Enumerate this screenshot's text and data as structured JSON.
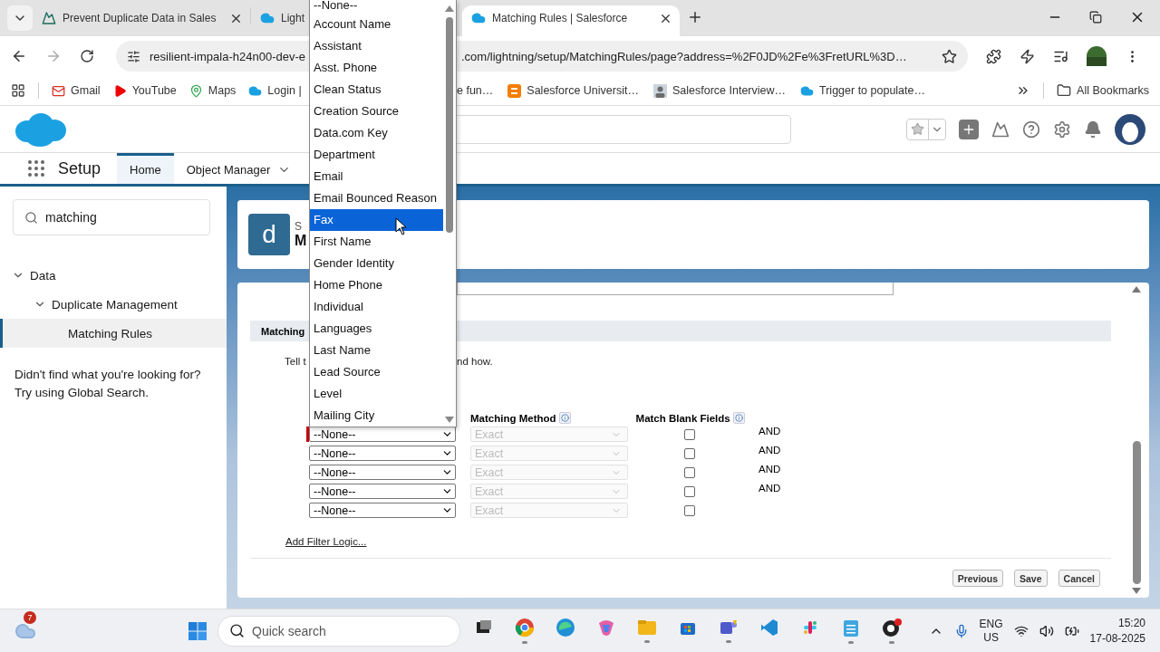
{
  "browser": {
    "tabs": [
      {
        "title": "Prevent Duplicate Data in Sales",
        "selected": false,
        "closable": true
      },
      {
        "title": "Light",
        "selected": false
      },
      {
        "title": "Matching Rules | Salesforce",
        "selected": true,
        "closable": true
      }
    ],
    "url_parts": [
      "resilient-impala-h24n00-dev-e",
      ".com/lightning/setup/MatchingRules/page?address=%2F0JD%2Fe%3FretURL%3D…"
    ],
    "bookmarks_left": [
      "Gmail",
      "YouTube",
      "Maps",
      "Login |"
    ],
    "bookmarks_right": [
      "e fun…",
      "Salesforce Universit…",
      "Salesforce Interview…",
      "Trigger to populate…"
    ],
    "all_bookmarks": "All Bookmarks"
  },
  "salesforce": {
    "nav": {
      "app": "Setup",
      "tabs": [
        {
          "label": "Home",
          "selected": true,
          "menu": false
        },
        {
          "label": "Object Manager",
          "selected": false,
          "menu": true
        }
      ]
    },
    "sidebar": {
      "search": "matching",
      "tree": [
        {
          "label": "Data",
          "expanded": true,
          "selected": false,
          "children": [
            {
              "label": "Duplicate Management",
              "expanded": true,
              "selected": false,
              "children": [
                {
                  "label": "Matching Rules",
                  "selected": true
                }
              ]
            }
          ]
        }
      ],
      "help": "Didn't find what you're looking for? Try using Global Search."
    },
    "page_header": {
      "icon_letter": "d",
      "subtitle": "S",
      "title": "M"
    },
    "form": {
      "section_title": "Matching",
      "description_parts": [
        "Tell t",
        "nd how."
      ],
      "columns": [
        "Matching Method",
        "Match Blank Fields"
      ],
      "rows": [
        {
          "field": "--None--",
          "method": "Exact",
          "method_disabled": true,
          "match_blank": false,
          "connector": "AND",
          "required": true
        },
        {
          "field": "--None--",
          "method": "Exact",
          "method_disabled": true,
          "match_blank": false,
          "connector": "AND",
          "required": false
        },
        {
          "field": "--None--",
          "method": "Exact",
          "method_disabled": true,
          "match_blank": false,
          "connector": "AND",
          "required": false
        },
        {
          "field": "--None--",
          "method": "Exact",
          "method_disabled": true,
          "match_blank": false,
          "connector": "AND",
          "required": false
        },
        {
          "field": "--None--",
          "method": "Exact",
          "method_disabled": true,
          "match_blank": false,
          "required": false
        }
      ],
      "filter_logic_link": "Add Filter Logic...",
      "buttons": [
        "Previous",
        "Save",
        "Cancel"
      ]
    },
    "picklist": {
      "options": [
        {
          "label": "--None--",
          "selected": false
        },
        {
          "label": "Account Name",
          "selected": false
        },
        {
          "label": "Assistant",
          "selected": false
        },
        {
          "label": "Asst. Phone",
          "selected": false
        },
        {
          "label": "Clean Status",
          "selected": false
        },
        {
          "label": "Creation Source",
          "selected": false
        },
        {
          "label": "Data.com Key",
          "selected": false
        },
        {
          "label": "Department",
          "selected": false
        },
        {
          "label": "Email",
          "selected": false
        },
        {
          "label": "Email Bounced Reason",
          "selected": false
        },
        {
          "label": "Fax",
          "selected": true
        },
        {
          "label": "First Name",
          "selected": false
        },
        {
          "label": "Gender Identity",
          "selected": false
        },
        {
          "label": "Home Phone",
          "selected": false
        },
        {
          "label": "Individual",
          "selected": false
        },
        {
          "label": "Languages",
          "selected": false
        },
        {
          "label": "Last Name",
          "selected": false
        },
        {
          "label": "Lead Source",
          "selected": false
        },
        {
          "label": "Level",
          "selected": false
        },
        {
          "label": "Mailing City",
          "selected": false
        }
      ]
    }
  },
  "taskbar": {
    "weather_badge": "7",
    "search_placeholder": "Quick search",
    "apps": [
      {
        "kind": "taskview",
        "running": false
      },
      {
        "kind": "browser",
        "running": true
      },
      {
        "kind": "swirl",
        "running": false
      },
      {
        "kind": "spark",
        "running": false
      },
      {
        "kind": "folder",
        "running": true
      },
      {
        "kind": "store",
        "running": false
      },
      {
        "kind": "chat",
        "running": true
      },
      {
        "kind": "code",
        "running": false
      },
      {
        "kind": "hash",
        "running": false
      },
      {
        "kind": "notepad",
        "running": true
      },
      {
        "kind": "record",
        "running": true
      }
    ],
    "language": "ENG",
    "region": "US",
    "time": "15:20",
    "date": "17-08-2025"
  }
}
